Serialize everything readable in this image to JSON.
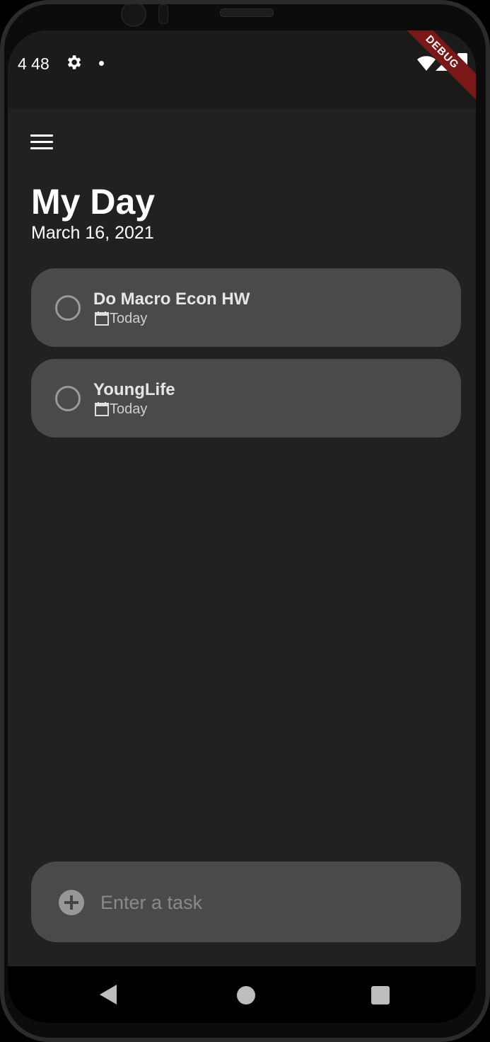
{
  "status_bar": {
    "time": "4 48",
    "icons": [
      "gear-icon",
      "notification-dot",
      "wifi-icon",
      "signal-icon",
      "battery-icon"
    ]
  },
  "debug_banner": "DEBUG",
  "header": {
    "menu_icon": "hamburger-menu-icon",
    "title": "My Day",
    "date": "March 16, 2021"
  },
  "tasks": [
    {
      "title": "Do Macro Econ HW",
      "due": "Today",
      "completed": false
    },
    {
      "title": "YoungLife",
      "due": "Today",
      "completed": false
    }
  ],
  "add_task": {
    "icon": "add-circle-icon",
    "placeholder": "Enter a task",
    "value": ""
  },
  "nav_bar": {
    "icons": [
      "back-icon",
      "home-icon",
      "recents-icon"
    ]
  },
  "colors": {
    "background": "#212121",
    "card": "#4a4a4a",
    "status_bar": "#1b1b1b",
    "debug": "#7a1717",
    "text": "#ffffff"
  }
}
